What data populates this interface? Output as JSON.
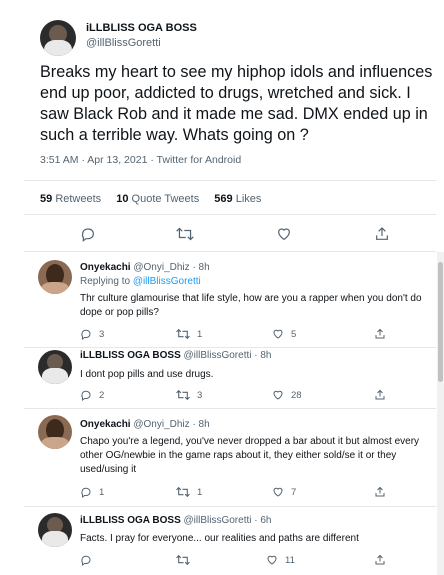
{
  "main": {
    "name": "iLLBLISS OGA BOSS",
    "handle": "@illBlissGoretti",
    "text": "Breaks my heart to see my hiphop idols and influences end up poor, addicted to drugs, wretched and sick. I saw Black Rob and it made me sad. DMX ended up in such a terrible way. Whats going on ?",
    "meta": "3:51 AM · Apr 13, 2021 · Twitter for Android",
    "retweets_count": "59",
    "retweets_label": "Retweets",
    "quotes_count": "10",
    "quotes_label": "Quote Tweets",
    "likes_count": "569",
    "likes_label": "Likes"
  },
  "replies": [
    {
      "name": "Onyekachi",
      "handle": "@Onyi_Dhiz",
      "time": "· 8h",
      "replying_prefix": "Replying to",
      "replying_to": "@illBlissGoretti",
      "text": "Thr culture glamourise that life style, how are you a rapper when you don't do dope or pop pills?",
      "replies": "3",
      "retweets": "1",
      "likes": "5"
    },
    {
      "name": "iLLBLISS OGA BOSS",
      "handle": "@illBlissGoretti",
      "time": "· 8h",
      "text": "I dont pop pills and use drugs.",
      "replies": "2",
      "retweets": "3",
      "likes": "28"
    },
    {
      "name": "Onyekachi",
      "handle": "@Onyi_Dhiz",
      "time": "· 8h",
      "text": "Chapo you're a legend, you've never dropped a bar about it but almost every other OG/newbie in the game raps about it, they either sold/se  it or they used/using it",
      "replies": "1",
      "retweets": "1",
      "likes": "7"
    },
    {
      "name": "iLLBLISS OGA BOSS",
      "handle": "@illBlissGoretti",
      "time": "· 6h",
      "text": "Facts. I pray for everyone... our realities and paths are different",
      "replies": "",
      "retweets": "",
      "likes": "11"
    }
  ],
  "icons": {
    "reply": "reply-icon",
    "retweet": "retweet-icon",
    "like": "heart-icon",
    "share": "share-icon"
  },
  "colors": {
    "link": "#1d9bf0",
    "muted": "#536471",
    "text": "#0f1419"
  }
}
